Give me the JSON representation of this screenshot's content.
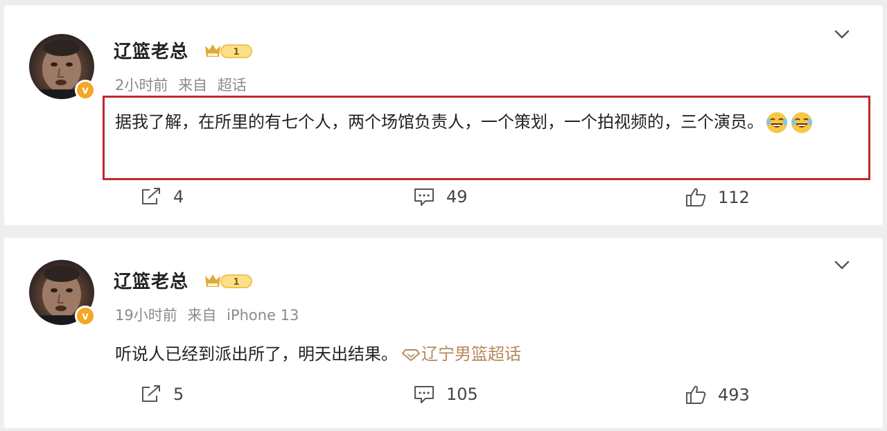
{
  "posts": [
    {
      "username": "辽篮老总",
      "vip_level": "1",
      "time": "2小时前",
      "source_prefix": "来自",
      "source": "超话",
      "text": "据我了解，在所里的有七个人，两个场馆负责人，一个策划，一个拍视频的，三个演员。",
      "emoji_count": 2,
      "highlighted": true,
      "reposts": "4",
      "comments": "49",
      "likes": "112"
    },
    {
      "username": "辽篮老总",
      "vip_level": "1",
      "time": "19小时前",
      "source_prefix": "来自",
      "source": "iPhone 13",
      "text": "听说人已经到派出所了，明天出结果。",
      "topic": "辽宁男篮超话",
      "highlighted": false,
      "reposts": "5",
      "comments": "105",
      "likes": "493"
    }
  ],
  "colors": {
    "highlight_border": "#c0282e",
    "topic_link": "#b38a5a",
    "verified_badge": "#f5a623",
    "vip_badge": "#f2c14e"
  },
  "icons": {
    "repost": "repost-icon",
    "comment": "comment-icon",
    "like": "thumbs-up-icon",
    "menu": "chevron-down-icon",
    "verified": "verified-badge-icon",
    "emoji": "laughing-tears-emoji-icon",
    "topic": "diamond-icon"
  }
}
